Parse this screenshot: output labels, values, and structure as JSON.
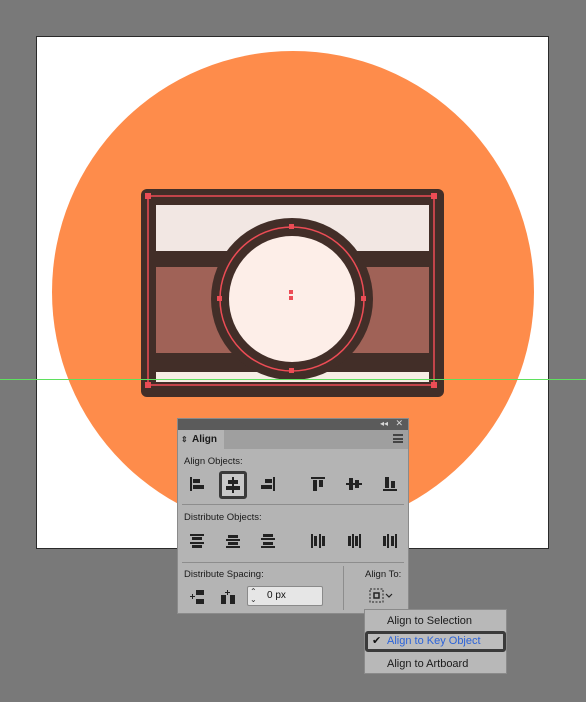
{
  "canvas": {
    "background_color": "#797979",
    "artboard_color": "#ffffff",
    "guide_color": "#5fe05f"
  },
  "illustration": {
    "background_circle_color": "#fe8c4b",
    "outline_color": "#422e28",
    "body_top_color": "#f2e7e3",
    "body_middle_color": "#a06257",
    "body_bottom_color": "#f6ede4",
    "lens_color": "#fdeee8",
    "selection_color": "#ec4c55"
  },
  "panel": {
    "tab_label": "Align",
    "align_objects_label": "Align Objects:",
    "distribute_objects_label": "Distribute Objects:",
    "distribute_spacing_label": "Distribute Spacing:",
    "align_to_label": "Align To:",
    "spacing_value": "0 px"
  },
  "dropdown": {
    "items": [
      "Align to Selection",
      "Align to Key Object",
      "Align to Artboard"
    ],
    "selected": "Align to Key Object",
    "selected_color": "#2b63d9"
  }
}
